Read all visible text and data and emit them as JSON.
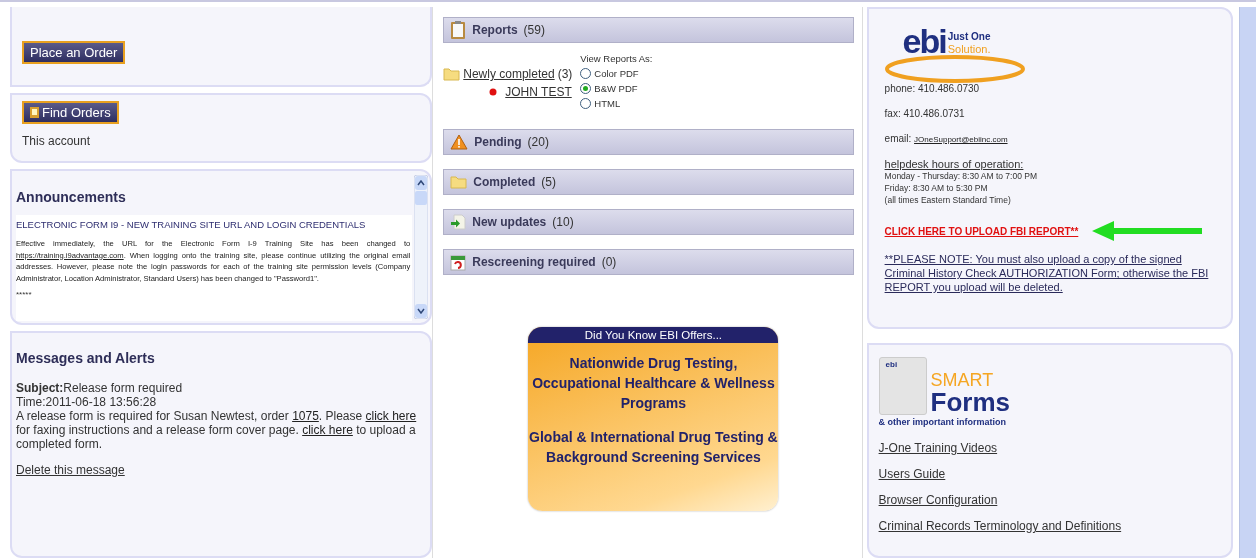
{
  "left": {
    "place_order": "Place an Order",
    "find_orders": "Find Orders",
    "account_text": "This account",
    "announcements": {
      "title": "Announcements",
      "items": [
        {
          "heading": "ELECTRONIC FORM I9 - NEW TRAINING SITE URL AND LOGIN CREDENTIALS",
          "body": [
            {
              "kind": "text",
              "text": "Effective immediately, the URL for the Electronic Form I-9 Training Site has been changed to "
            },
            {
              "kind": "link",
              "text": "https://training.i9advantage.com"
            },
            {
              "kind": "text",
              "text": ". When logging onto the training site, please continue utilizing the original email addresses. However, please note the login passwords for each of the training site permission levels (Company Administrator, Location Administrator, Standard Users) has been changed to \"Password1\"."
            }
          ],
          "separator": "*****"
        }
      ]
    },
    "messages": {
      "title": "Messages and Alerts",
      "subject": "**Subject:**Release form required",
      "time": "Time:2011-06-18 13:56:28",
      "body": [
        {
          "kind": "text",
          "text": "A release form is required for Susan Newtest, order "
        },
        {
          "kind": "link",
          "text": "1075"
        },
        {
          "kind": "text",
          "text": ". Please "
        },
        {
          "kind": "link",
          "text": "click here"
        },
        {
          "kind": "text",
          "text": " for faxing instructions and a release form cover page. "
        },
        {
          "kind": "link",
          "text": "click here"
        },
        {
          "kind": "text",
          "text": " to upload a completed form."
        }
      ],
      "delete": "Delete this message"
    }
  },
  "center": {
    "sections": [
      {
        "kind": "clipboard",
        "title": "Reports",
        "count": "(59)"
      },
      {
        "kind": "warning",
        "title": "Pending",
        "count": "(20)"
      },
      {
        "kind": "folder",
        "title": "Completed",
        "count": "(5)"
      },
      {
        "kind": "update",
        "title": "New updates",
        "count": "(10)"
      },
      {
        "kind": "calendar",
        "title": "Rescreening required",
        "count": "(0)"
      }
    ],
    "tree": {
      "label": "Newly completed",
      "count": "(3)",
      "children": [
        {
          "label": "JOHN TEST"
        }
      ]
    },
    "view_as": {
      "label": "View Reports As:",
      "options": [
        {
          "label": "Color PDF",
          "selected": false
        },
        {
          "label": "B&W PDF",
          "selected": true
        },
        {
          "label": "HTML",
          "selected": false
        }
      ]
    },
    "ad": {
      "header": "Did You Know EBI Offers...",
      "paragraphs": [
        "Nationwide Drug Testing, Occupational Healthcare & Wellness Programs",
        "Global & International Drug Testing & Background Screening Services"
      ]
    }
  },
  "right": {
    "logo": {
      "mark": "ebi",
      "line_1": "Just One",
      "line_2": "Solution."
    },
    "phone": {
      "label": "phone:",
      "value": "410.486.0730"
    },
    "fax": {
      "label": "fax:",
      "value": "410.486.0731"
    },
    "email": {
      "label": "email:",
      "value": "JOneSupport@ebiinc.com"
    },
    "hours": {
      "title": "helpdesk hours of operation:",
      "lines": [
        "Monday - Thursday: 8:30 AM to 7:00 PM",
        "Friday: 8:30 AM to 5:30 PM",
        "(all times Eastern Standard Time)"
      ]
    },
    "upload_link": "CLICK HERE TO UPLOAD FBI REPORT**",
    "note": "**PLEASE NOTE: You must also upload a copy of the signed Criminal History Check AUTHORIZATION Form; otherwise the FBI REPORT you upload will be deleted.",
    "smart_forms": {
      "doc_mark": "ebi",
      "line_1": "SMART",
      "line_2": "Forms",
      "tagline": "& other important information"
    },
    "links": [
      "J-One Training Videos",
      "Users Guide",
      "Browser Configuration",
      "Criminal Records Terminology and Definitions"
    ]
  }
}
